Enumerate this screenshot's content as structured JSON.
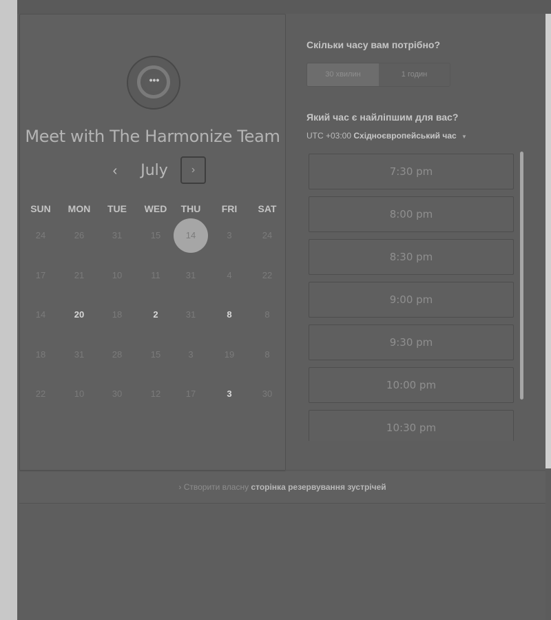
{
  "calendar": {
    "avatar_glyph": "•••",
    "title": "Meet with The Harmonize Team",
    "month": "July",
    "prev_label": "‹",
    "next_label": "›",
    "weekdays": [
      "SUN",
      "MON",
      "TUE",
      "WED",
      "THU",
      "FRI",
      "SAT"
    ],
    "weeks": [
      [
        "24",
        "26",
        "31",
        "15",
        "14",
        "3",
        "24"
      ],
      [
        "17",
        "21",
        "10",
        "11",
        "31",
        "4",
        "22"
      ],
      [
        "14",
        "20",
        "18",
        "2",
        "31",
        "8",
        "8"
      ],
      [
        "18",
        "31",
        "28",
        "15",
        "3",
        "19",
        "8"
      ],
      [
        "22",
        "10",
        "30",
        "12",
        "17",
        "3",
        "30"
      ]
    ],
    "available_days": [
      "2-1",
      "2-3",
      "2-5",
      "4-5"
    ],
    "selected_day": "0-4"
  },
  "booking": {
    "duration_question": "Скільки часу вам потрібно?",
    "durations": [
      "30 хвилин",
      "1 годин"
    ],
    "time_question": "Який час є найліпшим для вас?",
    "timezone_offset": "UTC +03:00",
    "timezone_name": "Східноєвропейський час",
    "slots": [
      "7:30 pm",
      "8:00 pm",
      "8:30 pm",
      "9:00 pm",
      "9:30 pm",
      "10:00 pm",
      "10:30 pm"
    ]
  },
  "footer": {
    "prefix": "Створити власну",
    "link": "сторінка резервування зустрічей"
  },
  "colors": {
    "selected_day": "#a6a6a6",
    "panel": "#606060"
  }
}
